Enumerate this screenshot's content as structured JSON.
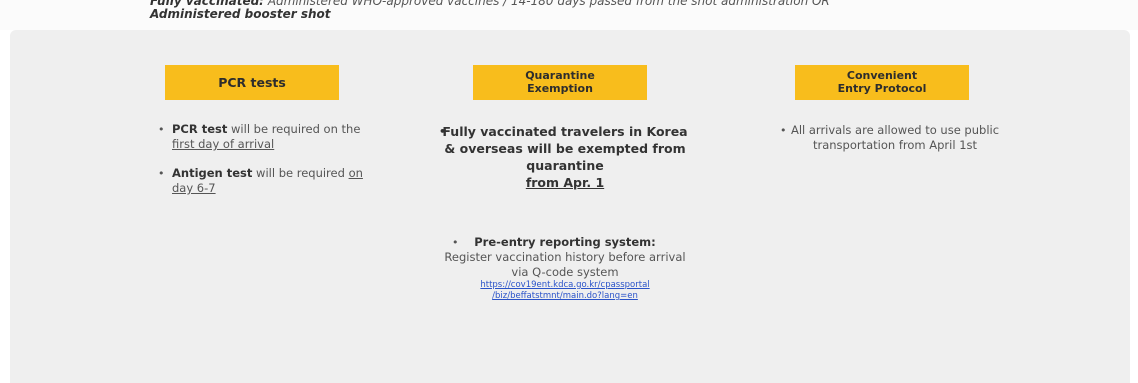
{
  "header": {
    "line1_bold": "Fully vaccinated:",
    "line1_text": "Administered WHO-approved vaccines / 14-180 days passed from the shot administration OR",
    "line2": "Administered booster shot"
  },
  "columns": {
    "pcr": {
      "title": "PCR tests",
      "bullet1_bold": "PCR test",
      "bullet1_text": " will be required on the ",
      "bullet1_underline": "first day of arrival",
      "bullet2_bold": "Antigen test",
      "bullet2_text": " will be required ",
      "bullet2_underline": "on day 6-7"
    },
    "quarantine": {
      "title_line1": "Quarantine",
      "title_line2": "Exemption",
      "bullet1_text": "Fully vaccinated travelers in Korea & overseas will be exempted from quarantine",
      "bullet1_underline": "from Apr. 1",
      "bullet2_bold": "Pre-entry reporting system:",
      "bullet2_text": "Register vaccination history before arrival via Q-code system",
      "link_line1": "https://cov19ent.kdca.go.kr/cpassportal",
      "link_line2": "/biz/beffatstmnt/main.do?lang=en"
    },
    "entry": {
      "title_line1": "Convenient",
      "title_line2": "Entry Protocol",
      "bullet1_text": "All arrivals are allowed to use public transportation from April 1st"
    }
  },
  "bullet_symbol": "•",
  "colors": {
    "badge": "#f8bd1c",
    "panel": "#efefef",
    "link": "#2a53c9"
  }
}
